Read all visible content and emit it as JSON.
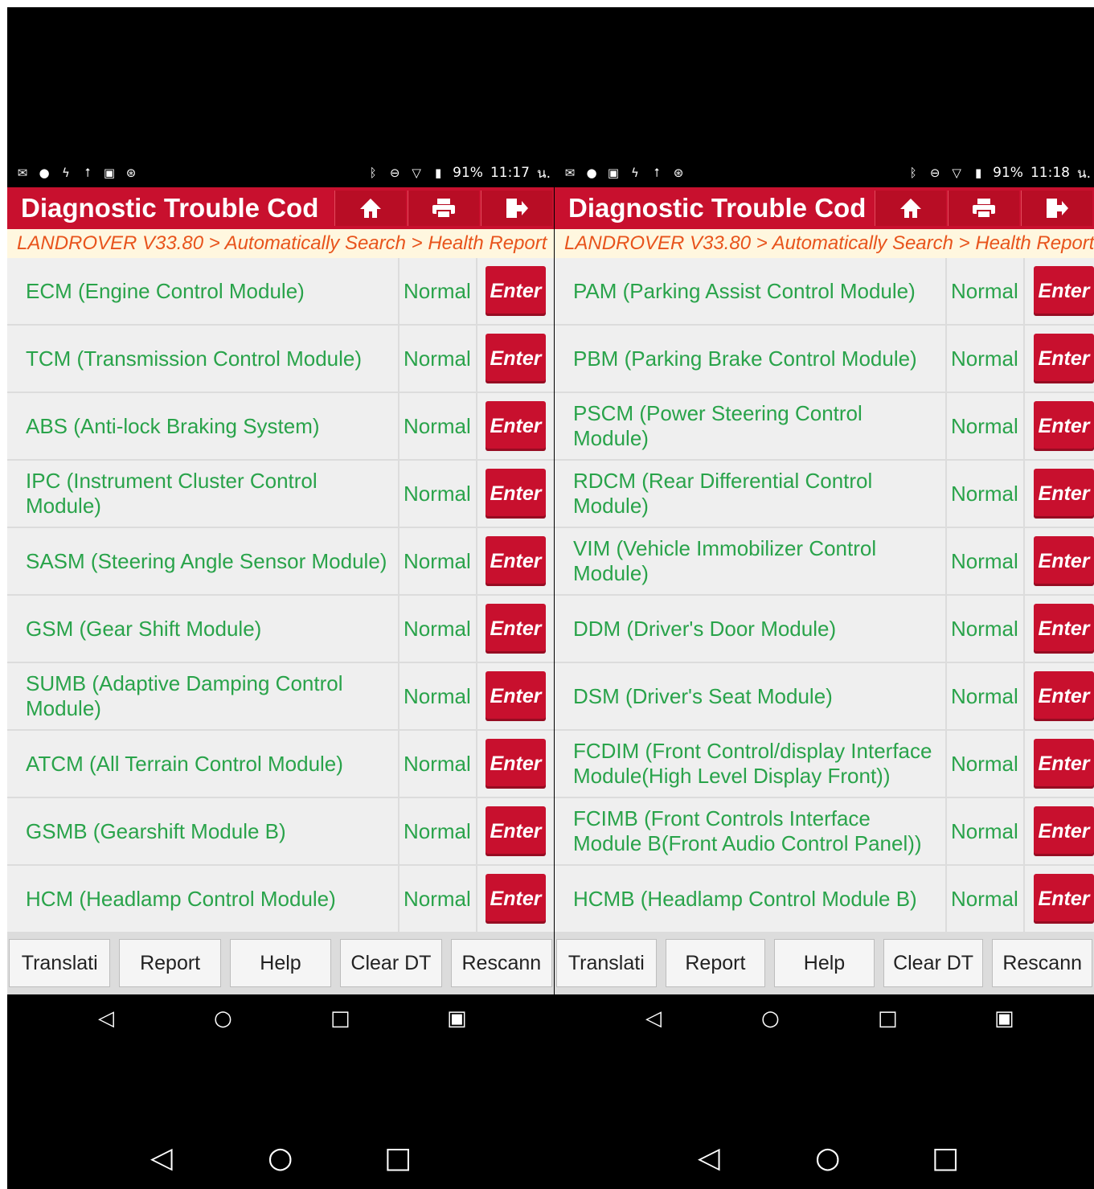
{
  "left": {
    "status": {
      "battery": "91%",
      "time": "11:17",
      "suffix": "น."
    },
    "title": "Diagnostic Trouble Cod",
    "breadcrumb": "LANDROVER V33.80 > Automatically Search > Health Report",
    "rows": [
      {
        "name": "ECM (Engine Control Module)",
        "status": "Normal",
        "action": "Enter"
      },
      {
        "name": "TCM (Transmission Control Module)",
        "status": "Normal",
        "action": "Enter"
      },
      {
        "name": "ABS (Anti-lock Braking System)",
        "status": "Normal",
        "action": "Enter"
      },
      {
        "name": "IPC (Instrument Cluster Control Module)",
        "status": "Normal",
        "action": "Enter"
      },
      {
        "name": "SASM (Steering Angle Sensor Module)",
        "status": "Normal",
        "action": "Enter"
      },
      {
        "name": "GSM (Gear Shift Module)",
        "status": "Normal",
        "action": "Enter"
      },
      {
        "name": "SUMB (Adaptive Damping Control Module)",
        "status": "Normal",
        "action": "Enter"
      },
      {
        "name": "ATCM (All Terrain Control Module)",
        "status": "Normal",
        "action": "Enter"
      },
      {
        "name": "GSMB (Gearshift Module B)",
        "status": "Normal",
        "action": "Enter"
      },
      {
        "name": "HCM (Headlamp Control Module)",
        "status": "Normal",
        "action": "Enter"
      }
    ],
    "buttons": [
      "Translati",
      "Report",
      "Help",
      "Clear DT",
      "Rescann"
    ]
  },
  "right": {
    "status": {
      "battery": "91%",
      "time": "11:18",
      "suffix": "น."
    },
    "title": "Diagnostic Trouble Cod",
    "breadcrumb": "LANDROVER V33.80 > Automatically Search > Health Report",
    "rows": [
      {
        "name": "PAM (Parking Assist Control Module)",
        "status": "Normal",
        "action": "Enter"
      },
      {
        "name": "PBM (Parking Brake Control Module)",
        "status": "Normal",
        "action": "Enter"
      },
      {
        "name": "PSCM (Power Steering Control Module)",
        "status": "Normal",
        "action": "Enter"
      },
      {
        "name": "RDCM (Rear Differential Control Module)",
        "status": "Normal",
        "action": "Enter"
      },
      {
        "name": "VIM (Vehicle Immobilizer Control Module)",
        "status": "Normal",
        "action": "Enter"
      },
      {
        "name": "DDM (Driver's Door Module)",
        "status": "Normal",
        "action": "Enter"
      },
      {
        "name": "DSM (Driver's Seat Module)",
        "status": "Normal",
        "action": "Enter"
      },
      {
        "name": "FCDIM (Front Control/display Interface Module(High Level Display Front))",
        "status": "Normal",
        "action": "Enter"
      },
      {
        "name": "FCIMB (Front Controls Interface Module B(Front Audio Control Panel))",
        "status": "Normal",
        "action": "Enter"
      },
      {
        "name": "HCMB (Headlamp Control Module B)",
        "status": "Normal",
        "action": "Enter"
      }
    ],
    "buttons": [
      "Translati",
      "Report",
      "Help",
      "Clear DT",
      "Rescann"
    ]
  },
  "icons": {
    "home": "home-icon",
    "print": "printer-icon",
    "exit": "exit-icon",
    "nav": [
      "back-icon",
      "home-circle-icon",
      "recents-icon",
      "screenshot-icon"
    ]
  },
  "colors": {
    "accent": "#c8102e",
    "ok_text": "#29a34a",
    "breadcrumb": "#e8541c"
  }
}
